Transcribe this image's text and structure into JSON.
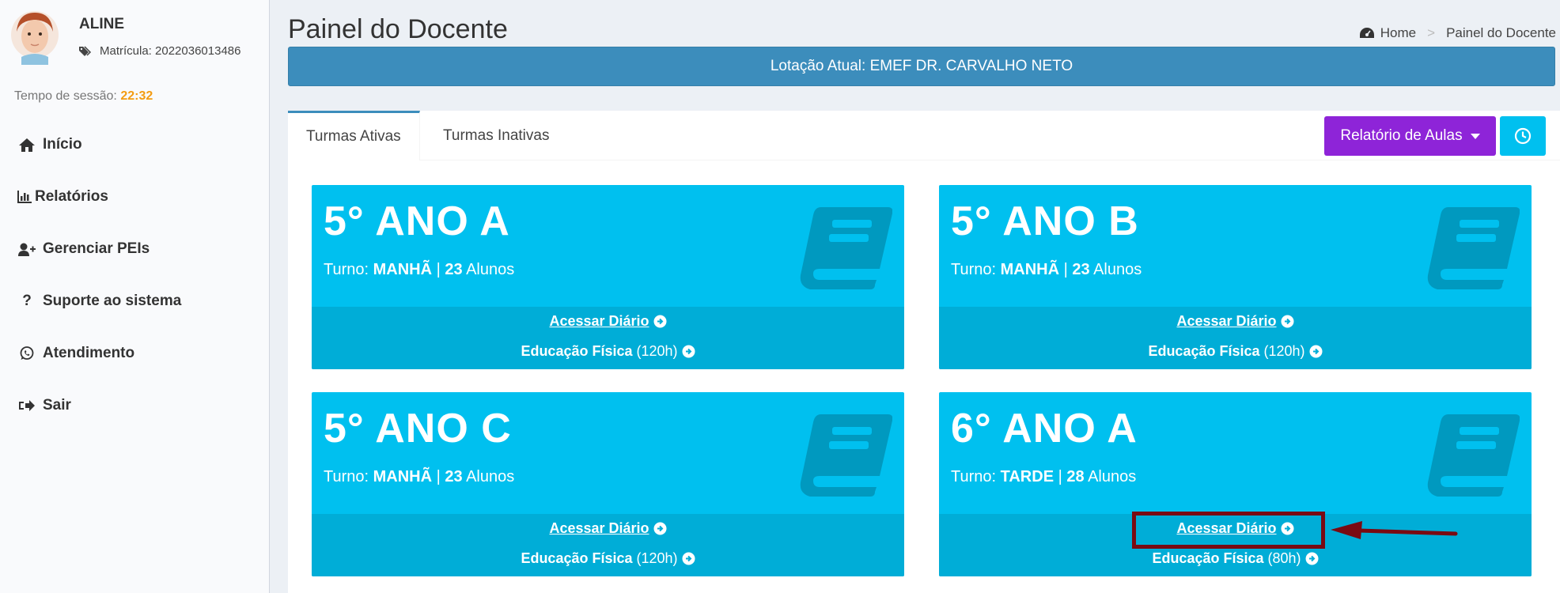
{
  "user": {
    "name": "ALINE",
    "matricula": "Matrícula: 2022036013486"
  },
  "session": {
    "label": "Tempo de sessão:",
    "time": "22:32"
  },
  "menu": [
    {
      "label": "Início",
      "icon": "home-icon"
    },
    {
      "label": "Relatórios",
      "icon": "bar-chart-icon"
    },
    {
      "label": "Gerenciar PEIs",
      "icon": "user-plus-icon"
    },
    {
      "label": "Suporte ao sistema",
      "icon": "question-icon"
    },
    {
      "label": "Atendimento",
      "icon": "whatsapp-icon"
    },
    {
      "label": "Sair",
      "icon": "sign-out-icon"
    }
  ],
  "header": {
    "title": "Painel do Docente"
  },
  "breadcrumb": {
    "home": "Home",
    "current": "Painel do Docente"
  },
  "lotacao": "Lotação Atual: EMEF DR. CARVALHO NETO",
  "tabs": [
    {
      "label": "Turmas Ativas"
    },
    {
      "label": "Turmas Inativas"
    }
  ],
  "buttons": {
    "relatorio": "Relatório de Aulas"
  },
  "cards": [
    {
      "name": "5° ANO A",
      "turno_label": "Turno:",
      "turno": "MANHÃ",
      "sep": "|",
      "alunos": "23",
      "alunos_label": "Alunos",
      "acessar": "Acessar Diário",
      "disciplina": "Educação Física",
      "carga": "(120h)"
    },
    {
      "name": "5° ANO B",
      "turno_label": "Turno:",
      "turno": "MANHÃ",
      "sep": "|",
      "alunos": "23",
      "alunos_label": "Alunos",
      "acessar": "Acessar Diário",
      "disciplina": "Educação Física",
      "carga": "(120h)"
    },
    {
      "name": "5° ANO C",
      "turno_label": "Turno:",
      "turno": "MANHÃ",
      "sep": "|",
      "alunos": "23",
      "alunos_label": "Alunos",
      "acessar": "Acessar Diário",
      "disciplina": "Educação Física",
      "carga": "(120h)"
    },
    {
      "name": "6° ANO A",
      "turno_label": "Turno:",
      "turno": "TARDE",
      "sep": "|",
      "alunos": "28",
      "alunos_label": "Alunos",
      "acessar": "Acessar Diário",
      "disciplina": "Educação Física",
      "carga": "(80h)"
    }
  ],
  "colors": {
    "card": "#00c0ef",
    "card_footer": "#00add7",
    "primary": "#3c8dbc",
    "purple": "#8e24d8",
    "highlight": "#7a0a12",
    "session_time": "#f39c12"
  }
}
